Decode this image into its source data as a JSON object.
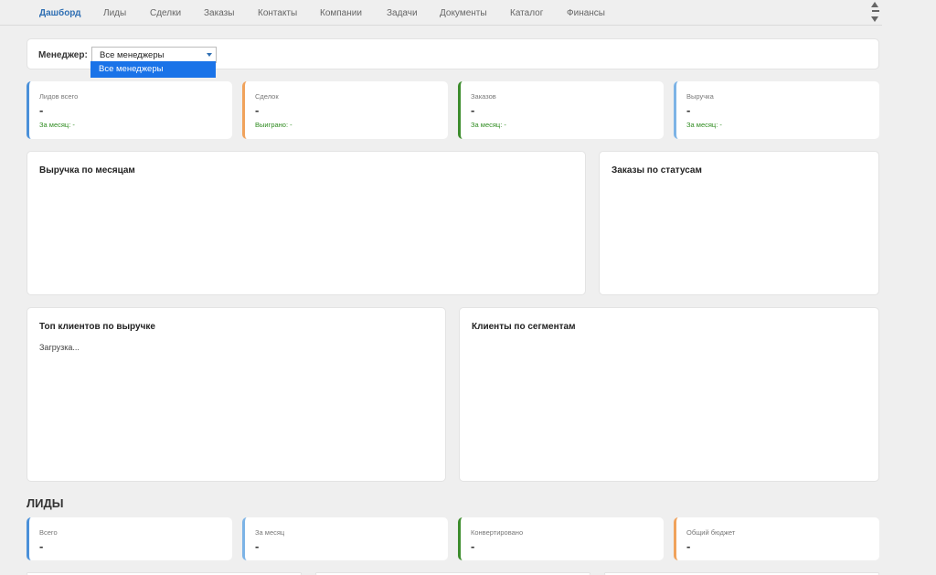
{
  "nav": {
    "items": [
      {
        "label": "Дашборд",
        "active": true
      },
      {
        "label": "Лиды"
      },
      {
        "label": "Сделки"
      },
      {
        "label": "Заказы"
      },
      {
        "label": "Контакты"
      },
      {
        "label": "Компании"
      },
      {
        "label": "Задачи"
      },
      {
        "label": "Документы"
      },
      {
        "label": "Каталог"
      },
      {
        "label": "Финансы"
      }
    ]
  },
  "filter": {
    "label": "Менеджер:",
    "selected": "Все менеджеры",
    "options": [
      "Все менеджеры"
    ]
  },
  "stats": [
    {
      "label": "Лидов всего",
      "value": "-",
      "sub": "За месяц: -",
      "color": "#4a90d9"
    },
    {
      "label": "Сделок",
      "value": "-",
      "sub": "Выиграно: -",
      "color": "#f0a25b"
    },
    {
      "label": "Заказов",
      "value": "-",
      "sub": "За месяц: -",
      "color": "#3c8c2c"
    },
    {
      "label": "Выручка",
      "value": "-",
      "sub": "За месяц: -",
      "color": "#7cb3e6"
    }
  ],
  "panels": {
    "revenue_by_month": {
      "title": "Выручка по месяцам"
    },
    "orders_by_status": {
      "title": "Заказы по статусам"
    },
    "top_clients": {
      "title": "Топ клиентов по выручке",
      "status": "Загрузка..."
    },
    "clients_by_segment": {
      "title": "Клиенты по сегментам"
    }
  },
  "leads_section": {
    "title": "ЛИДЫ",
    "stats": [
      {
        "label": "Всего",
        "value": "-",
        "color": "#4a90d9"
      },
      {
        "label": "За месяц",
        "value": "-",
        "color": "#7cb3e6"
      },
      {
        "label": "Конвертировано",
        "value": "-",
        "color": "#3c8c2c"
      },
      {
        "label": "Общий бюджет",
        "value": "-",
        "color": "#f0a25b"
      }
    ]
  }
}
